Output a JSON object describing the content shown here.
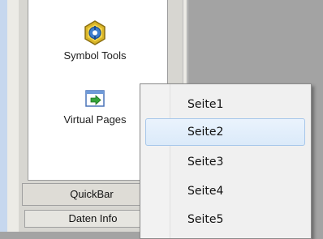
{
  "sidebar": {
    "tools": [
      {
        "label": "Symbol Tools",
        "icon": "symbol-tools-icon"
      },
      {
        "label": "Virtual Pages",
        "icon": "virtual-pages-icon"
      }
    ],
    "tabs": [
      {
        "label": "QuickBar"
      },
      {
        "label": "Daten Info"
      }
    ]
  },
  "popup_menu": {
    "items": [
      {
        "label": "Seite1"
      },
      {
        "label": "Seite2",
        "highlighted": true
      },
      {
        "label": "Seite3"
      },
      {
        "label": "Seite4"
      },
      {
        "label": "Seite5"
      }
    ]
  },
  "colors": {
    "highlight_border": "#a7c7ea",
    "highlight_fill": "#dbeaf9",
    "left_strip": "#c6d7ee",
    "desktop_gray": "#a3a3a3"
  }
}
